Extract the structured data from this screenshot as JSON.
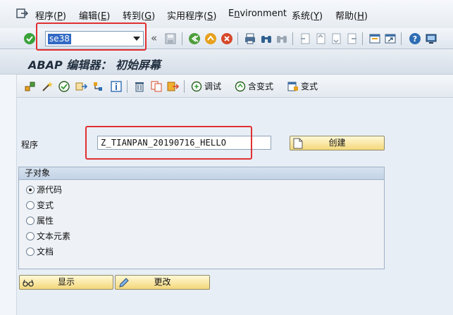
{
  "menu": {
    "items": [
      {
        "text": "程序(",
        "key": "P",
        "close": ")"
      },
      {
        "text": "编辑(",
        "key": "E",
        "close": ")"
      },
      {
        "text": "转到(",
        "key": "G",
        "close": ")"
      },
      {
        "text": "实用程序(",
        "key": "S",
        "close": ")"
      },
      {
        "text": "E",
        "key": "n",
        "close": "vironment"
      },
      {
        "text": "系统(",
        "key": "Y",
        "close": ")"
      },
      {
        "text": "帮助(",
        "key": "H",
        "close": ")"
      }
    ]
  },
  "command_field": {
    "value": "se38"
  },
  "window_title": "ABAP 编辑器： 初始屏幕",
  "app_toolbar": {
    "debug_label": "调试",
    "with_variant_label": "含变式",
    "variant_label": "变式"
  },
  "form": {
    "program_label": "程序",
    "program_value": "Z_TIANPAN_20190716_HELLO",
    "create_button": "创建"
  },
  "subobjects": {
    "title": "子对象",
    "options": [
      {
        "label": "源代码",
        "selected": true
      },
      {
        "label": "变式",
        "selected": false
      },
      {
        "label": "属性",
        "selected": false
      },
      {
        "label": "文本元素",
        "selected": false
      },
      {
        "label": "文档",
        "selected": false
      }
    ]
  },
  "actions": {
    "display_label": "显示",
    "change_label": "更改"
  },
  "colors": {
    "highlight": "#e03030",
    "button_face": "#f3d77a",
    "selection": "#316ac5"
  }
}
